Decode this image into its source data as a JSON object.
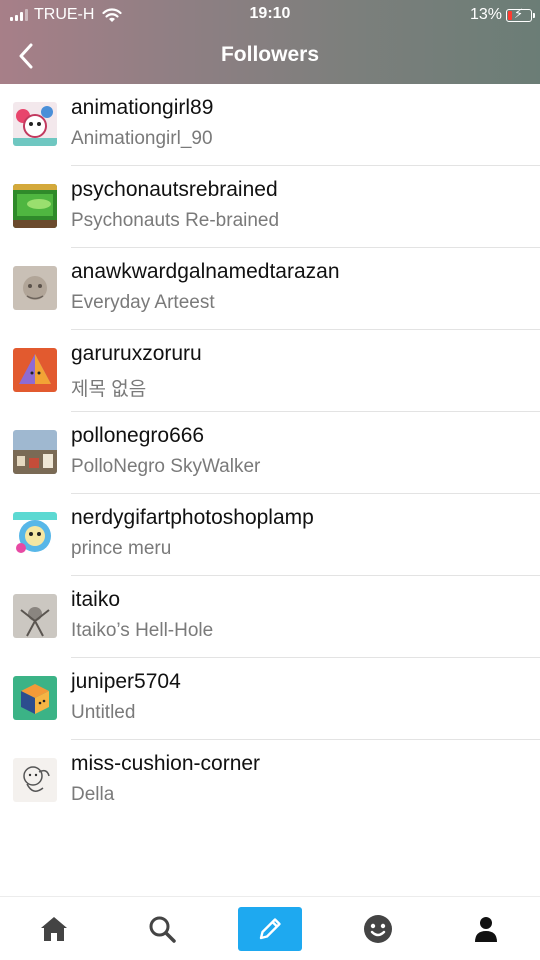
{
  "status": {
    "carrier": "TRUE-H",
    "time": "19:10",
    "battery": "13%"
  },
  "nav": {
    "title": "Followers"
  },
  "followers": [
    {
      "name": "animationgirl89",
      "title": "Animationgirl_90"
    },
    {
      "name": "psychonautsrebrained",
      "title": "Psychonauts Re-brained"
    },
    {
      "name": "anawkwardgalnamedtarazan",
      "title": "Everyday Arteest"
    },
    {
      "name": "garuruxzoruru",
      "title": "제목 없음"
    },
    {
      "name": "pollonegro666",
      "title": "PolloNegro SkyWalker"
    },
    {
      "name": "nerdygifartphotoshoplamp",
      "title": "prince meru"
    },
    {
      "name": "itaiko",
      "title": "Itaiko’s Hell-Hole"
    },
    {
      "name": "juniper5704",
      "title": "Untitled"
    },
    {
      "name": "miss-cushion-corner",
      "title": "Della"
    }
  ],
  "tabbar": {
    "icons": [
      "home-icon",
      "search-icon",
      "compose-pencil-icon",
      "activity-face-icon",
      "account-person-icon"
    ],
    "accent": "#1ea9f0"
  },
  "colors": {
    "header_start": "#a77f88",
    "header_end": "#6b7d76",
    "subtitle": "#7a7a7a"
  }
}
